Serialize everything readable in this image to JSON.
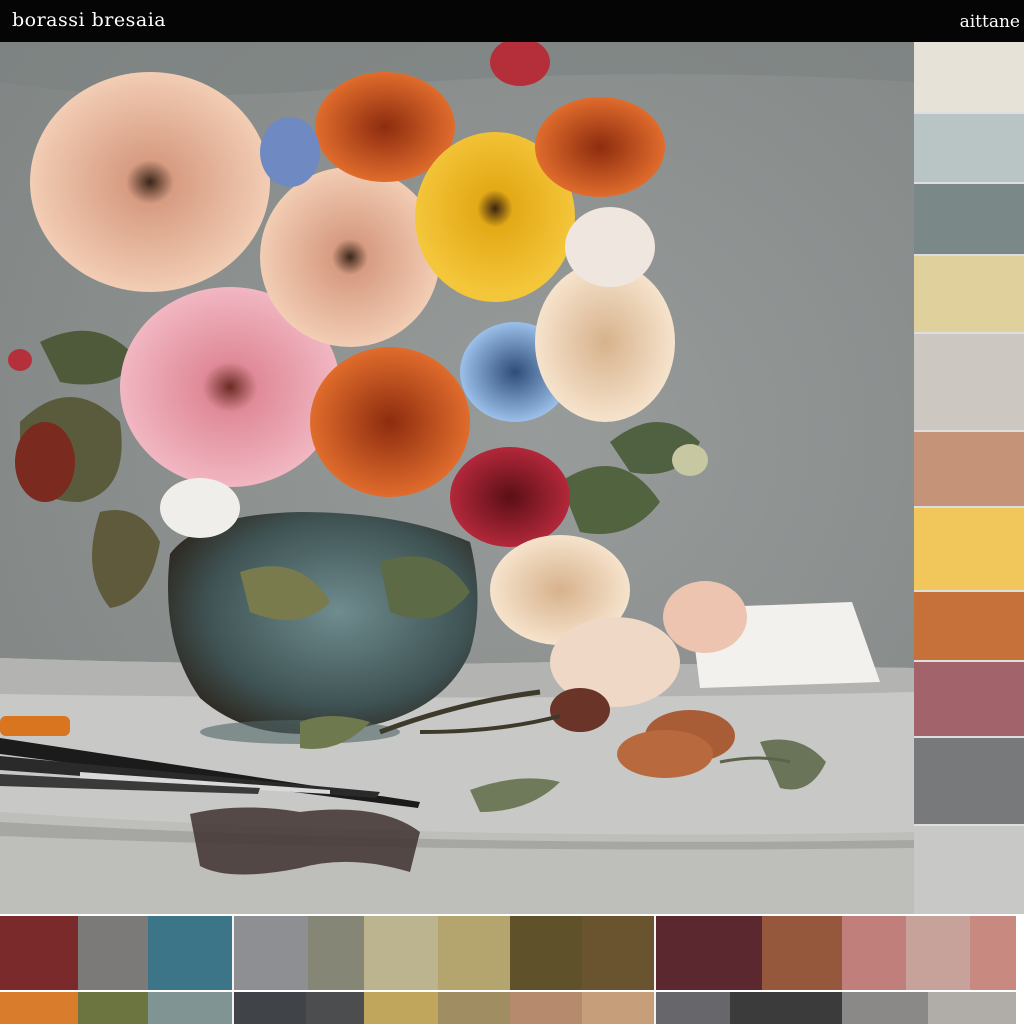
{
  "header": {
    "title": "borassi bresaia",
    "right_label": "aittane"
  },
  "side_palette": [
    {
      "name": "swatch-1",
      "color": "#e7e2d8",
      "h": 72
    },
    {
      "name": "swatch-2",
      "color": "#b9c4c4",
      "h": 70
    },
    {
      "name": "swatch-3",
      "color": "#7a8887",
      "h": 72
    },
    {
      "name": "swatch-4",
      "color": "#dfd09c",
      "h": 78
    },
    {
      "name": "swatch-5",
      "color": "#cdc7c1",
      "h": 98
    },
    {
      "name": "swatch-6",
      "color": "#c59478",
      "h": 76
    },
    {
      "name": "swatch-7",
      "color": "#f1c75c",
      "h": 84
    },
    {
      "name": "swatch-8",
      "color": "#c6703a",
      "h": 70
    },
    {
      "name": "swatch-9",
      "color": "#a2646a",
      "h": 76
    },
    {
      "name": "swatch-10",
      "color": "#77797a",
      "h": 88
    }
  ],
  "bottom_palette_row1": [
    {
      "color": "#7a2a2a",
      "w": 78
    },
    {
      "color": "#7b7a78",
      "w": 70
    },
    {
      "color": "#3d7588",
      "w": 84
    },
    {
      "gap": true
    },
    {
      "color": "#8d8f92",
      "w": 74
    },
    {
      "color": "#868677",
      "w": 56
    },
    {
      "color": "#bbb48e",
      "w": 74
    },
    {
      "color": "#b4a56f",
      "w": 72
    },
    {
      "color": "#5f522b",
      "w": 72
    },
    {
      "color": "#6a5430",
      "w": 72
    },
    {
      "gap": true
    },
    {
      "color": "#5b2830",
      "w": 106
    },
    {
      "color": "#96583c",
      "w": 80
    },
    {
      "color": "#c07f7b",
      "w": 64
    },
    {
      "color": "#c6a29a",
      "w": 64
    },
    {
      "color": "#c88a80",
      "w": 46
    }
  ],
  "bottom_palette_row2": [
    {
      "color": "#d97d2c",
      "w": 78
    },
    {
      "color": "#6c7440",
      "w": 70
    },
    {
      "color": "#809494",
      "w": 84
    },
    {
      "gap": true
    },
    {
      "color": "#404448",
      "w": 72
    },
    {
      "color": "#4c4d4f",
      "w": 58
    },
    {
      "color": "#c0a55c",
      "w": 74
    },
    {
      "color": "#a08d61",
      "w": 72
    },
    {
      "color": "#b58a6d",
      "w": 72
    },
    {
      "color": "#c79e7a",
      "w": 72
    },
    {
      "gap": true
    },
    {
      "color": "#66666b",
      "w": 74
    },
    {
      "color": "#3b3b3b",
      "w": 112
    },
    {
      "color": "#8b8888",
      "w": 86
    },
    {
      "color": "#b0aca7",
      "w": 88
    }
  ]
}
